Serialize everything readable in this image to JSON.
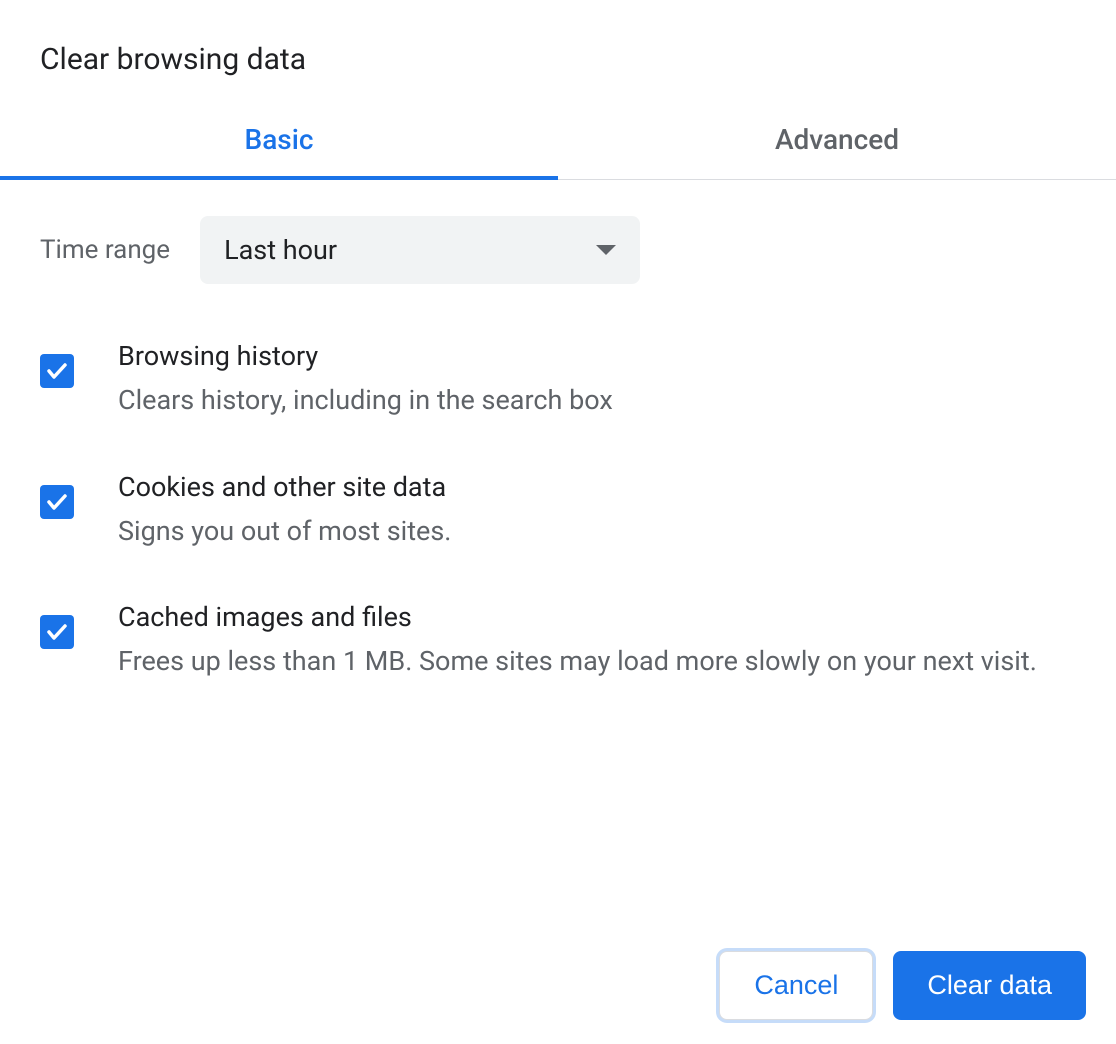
{
  "dialog": {
    "title": "Clear browsing data"
  },
  "tabs": {
    "basic": "Basic",
    "advanced": "Advanced"
  },
  "timeRange": {
    "label": "Time range",
    "value": "Last hour"
  },
  "options": [
    {
      "title": "Browsing history",
      "desc": "Clears history, including in the search box",
      "checked": true
    },
    {
      "title": "Cookies and other site data",
      "desc": "Signs you out of most sites.",
      "checked": true
    },
    {
      "title": "Cached images and files",
      "desc": "Frees up less than 1 MB. Some sites may load more slowly on your next visit.",
      "checked": true
    }
  ],
  "buttons": {
    "cancel": "Cancel",
    "clear": "Clear data"
  }
}
